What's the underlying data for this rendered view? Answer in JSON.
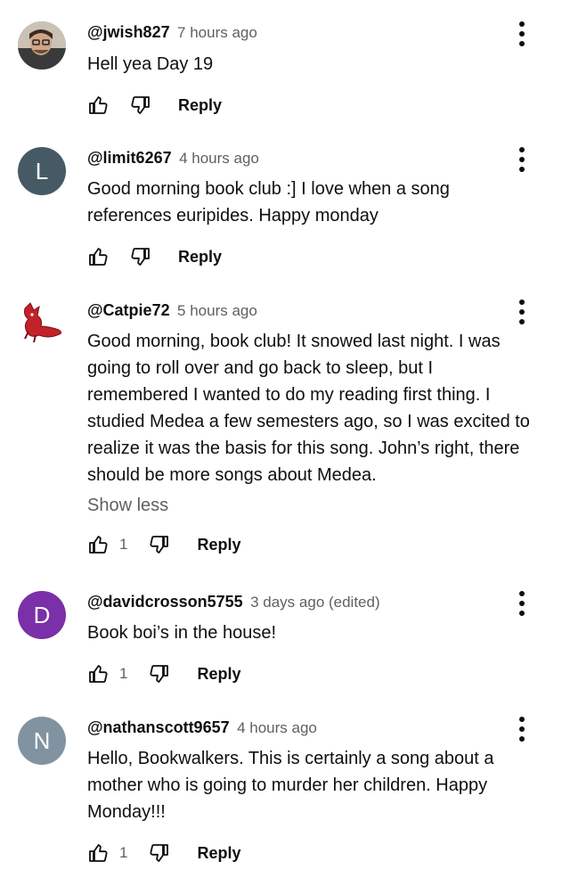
{
  "comments": [
    {
      "handle": "@jwish827",
      "time": "7 hours ago",
      "text": "Hell yea Day 19",
      "likes": "",
      "reply_label": "Reply",
      "avatar": {
        "type": "photo",
        "color": "#a99a86"
      }
    },
    {
      "handle": "@limit6267",
      "time": "4 hours ago",
      "text": "Good morning book club :] I love when a song references euripides. Happy monday",
      "likes": "",
      "reply_label": "Reply",
      "avatar": {
        "type": "letter",
        "letter": "L",
        "color": "#455a64"
      }
    },
    {
      "handle": "@Catpie72",
      "time": "5 hours ago",
      "text": "Good morning, book club! It snowed last night. I was going to roll over and go back to sleep, but I remembered I wanted to do my reading first thing. I studied Medea a few semesters ago, so I was excited to realize it was the basis for this song. John’s right, there should be more songs about Medea.",
      "show_less": "Show less",
      "likes": "1",
      "reply_label": "Reply",
      "avatar": {
        "type": "drawing",
        "color": "#ffffff",
        "accent": "#c4222a"
      }
    },
    {
      "handle": "@davidcrosson5755",
      "time": "3 days ago (edited)",
      "text": "Book boi’s in the house!",
      "likes": "1",
      "reply_label": "Reply",
      "avatar": {
        "type": "letter",
        "letter": "D",
        "color": "#7b2fa8"
      }
    },
    {
      "handle": "@nathanscott9657",
      "time": "4 hours ago",
      "text": "Hello, Bookwalkers. This is certainly a song about a mother who is going to murder her children. Happy Monday!!!",
      "likes": "1",
      "reply_label": "Reply",
      "avatar": {
        "type": "letter",
        "letter": "N",
        "color": "#8193a0"
      }
    }
  ],
  "icons": {
    "like": "thumb-up-outline",
    "dislike": "thumb-down-outline",
    "menu": "vertical-ellipsis"
  }
}
